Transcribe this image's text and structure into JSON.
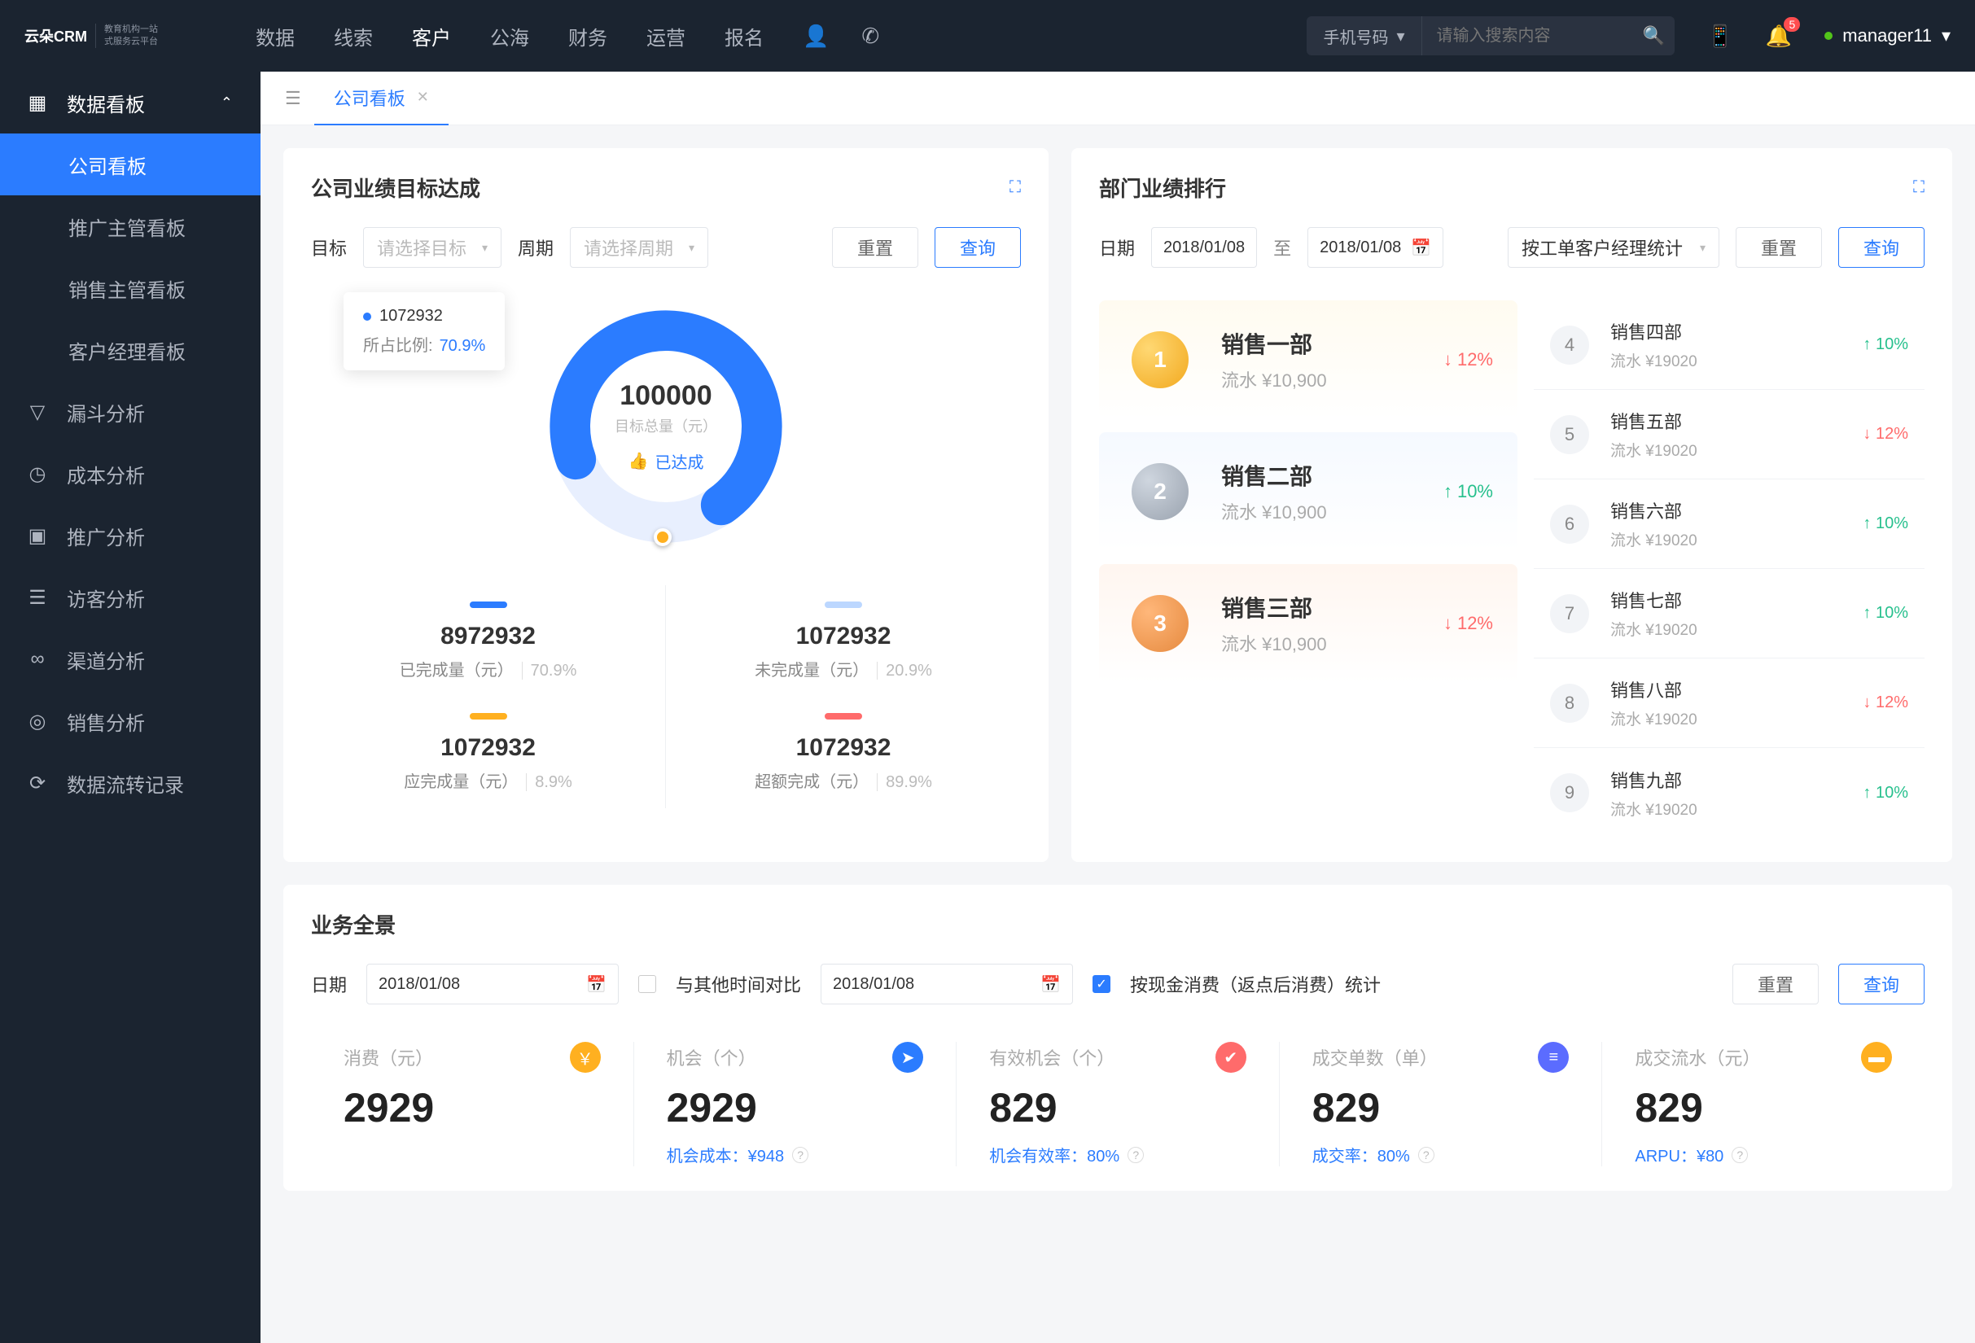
{
  "topnav": {
    "brand": "云朵CRM",
    "brand_sub": "教育机构一站\n式服务云平台",
    "items": [
      "数据",
      "线索",
      "客户",
      "公海",
      "财务",
      "运营",
      "报名"
    ],
    "active_index": 2,
    "search_type": "手机号码",
    "search_placeholder": "请输入搜索内容",
    "badge": "5",
    "user": "manager11"
  },
  "sidebar": {
    "group": "数据看板",
    "subs": [
      "公司看板",
      "推广主管看板",
      "销售主管看板",
      "客户经理看板"
    ],
    "active_sub": 0,
    "items": [
      "漏斗分析",
      "成本分析",
      "推广分析",
      "访客分析",
      "渠道分析",
      "销售分析",
      "数据流转记录"
    ]
  },
  "tabs": {
    "current": "公司看板"
  },
  "goal_panel": {
    "title": "公司业绩目标达成",
    "label_target": "目标",
    "target_placeholder": "请选择目标",
    "label_period": "周期",
    "period_placeholder": "请选择周期",
    "reset": "重置",
    "query": "查询",
    "tooltip_value": "1072932",
    "tooltip_label": "所占比例:",
    "tooltip_pct": "70.9%",
    "center_value": "100000",
    "center_label": "目标总量（元）",
    "center_badge": "已达成",
    "stats": [
      {
        "bar": "#2b7cff",
        "num": "8972932",
        "desc": "已完成量（元）",
        "pct": "70.9%"
      },
      {
        "bar": "#bcd7ff",
        "num": "1072932",
        "desc": "未完成量（元）",
        "pct": "20.9%"
      },
      {
        "bar": "#ffb020",
        "num": "1072932",
        "desc": "应完成量（元）",
        "pct": "8.9%"
      },
      {
        "bar": "#ff6b6b",
        "num": "1072932",
        "desc": "超额完成（元）",
        "pct": "89.9%"
      }
    ]
  },
  "rank_panel": {
    "title": "部门业绩排行",
    "label_date": "日期",
    "date_from": "2018/01/08",
    "date_sep": "至",
    "date_to": "2018/01/08",
    "group_by": "按工单客户经理统计",
    "reset": "重置",
    "query": "查询",
    "top3": [
      {
        "rank": "1",
        "name": "销售一部",
        "sub": "流水 ¥10,900",
        "delta": "12%",
        "dir": "down"
      },
      {
        "rank": "2",
        "name": "销售二部",
        "sub": "流水 ¥10,900",
        "delta": "10%",
        "dir": "up"
      },
      {
        "rank": "3",
        "name": "销售三部",
        "sub": "流水 ¥10,900",
        "delta": "12%",
        "dir": "down"
      }
    ],
    "rest": [
      {
        "rank": "4",
        "name": "销售四部",
        "sub": "流水 ¥19020",
        "delta": "10%",
        "dir": "up"
      },
      {
        "rank": "5",
        "name": "销售五部",
        "sub": "流水 ¥19020",
        "delta": "12%",
        "dir": "down"
      },
      {
        "rank": "6",
        "name": "销售六部",
        "sub": "流水 ¥19020",
        "delta": "10%",
        "dir": "up"
      },
      {
        "rank": "7",
        "name": "销售七部",
        "sub": "流水 ¥19020",
        "delta": "10%",
        "dir": "up"
      },
      {
        "rank": "8",
        "name": "销售八部",
        "sub": "流水 ¥19020",
        "delta": "12%",
        "dir": "down"
      },
      {
        "rank": "9",
        "name": "销售九部",
        "sub": "流水 ¥19020",
        "delta": "10%",
        "dir": "up"
      }
    ]
  },
  "overview": {
    "title": "业务全景",
    "label_date": "日期",
    "date": "2018/01/08",
    "compare_label": "与其他时间对比",
    "date2": "2018/01/08",
    "checkbox_label": "按现金消费（返点后消费）统计",
    "reset": "重置",
    "query": "查询",
    "kpis": [
      {
        "label": "消费（元）",
        "icon": "💰",
        "color": "#ffb020",
        "value": "2929",
        "foot": ""
      },
      {
        "label": "机会（个）",
        "icon": "➤",
        "color": "#2b7cff",
        "value": "2929",
        "foot": "机会成本：¥948"
      },
      {
        "label": "有效机会（个）",
        "icon": "✔",
        "color": "#ff6b6b",
        "value": "829",
        "foot": "机会有效率：80%"
      },
      {
        "label": "成交单数（单）",
        "icon": "≡",
        "color": "#5b6cff",
        "value": "829",
        "foot": "成交率：80%"
      },
      {
        "label": "成交流水（元）",
        "icon": "▬",
        "color": "#ffb020",
        "value": "829",
        "foot": "ARPU：¥80"
      }
    ]
  },
  "chart_data": {
    "type": "pie",
    "title": "公司业绩目标达成",
    "total_label": "目标总量（元）",
    "total": 100000,
    "series": [
      {
        "name": "已完成量（元）",
        "value": 8972932,
        "pct": 70.9,
        "color": "#2b7cff"
      },
      {
        "name": "未完成量（元）",
        "value": 1072932,
        "pct": 20.9,
        "color": "#bcd7ff"
      },
      {
        "name": "应完成量（元）",
        "value": 1072932,
        "pct": 8.9,
        "color": "#ffb020"
      },
      {
        "name": "超额完成（元）",
        "value": 1072932,
        "pct": 89.9,
        "color": "#ff6b6b"
      }
    ],
    "highlight": {
      "value": 1072932,
      "pct": 70.9
    }
  }
}
